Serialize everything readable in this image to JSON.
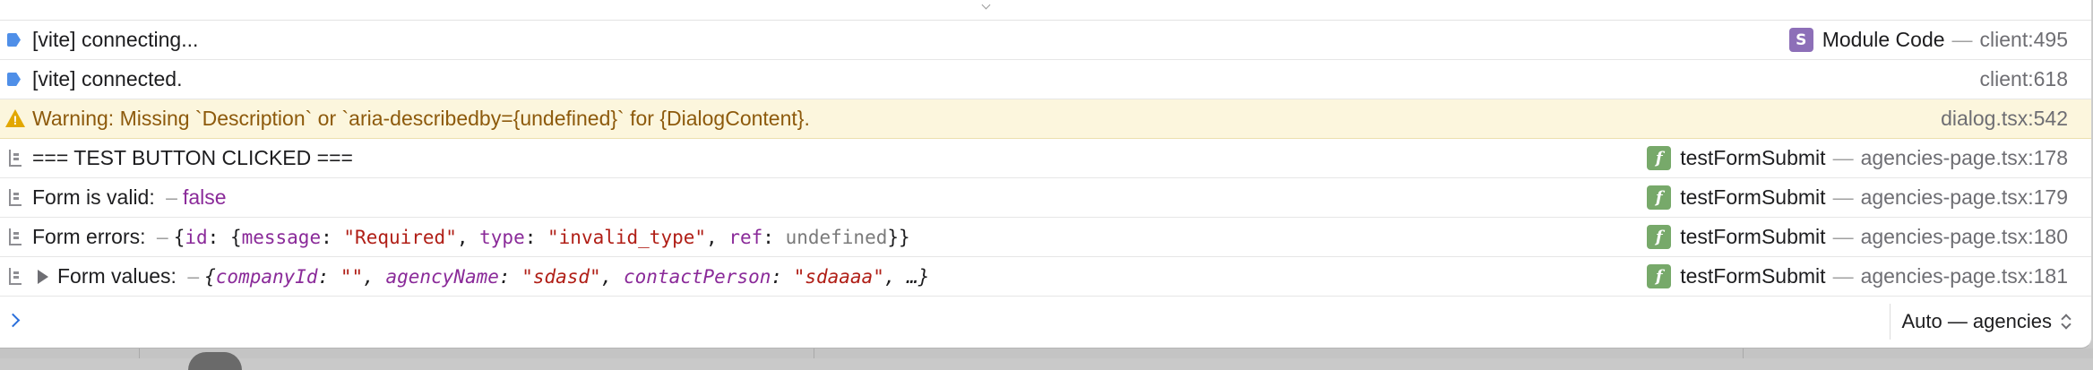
{
  "console": {
    "rows": [
      {
        "type": "log",
        "icon": "vite-log-icon",
        "text": "[vite] connecting...",
        "badge": "S",
        "badge_color": "#8d6fb8",
        "source_fn": "Module Code",
        "location": "client:495"
      },
      {
        "type": "log",
        "icon": "vite-log-icon",
        "text": "[vite] connected.",
        "location": "client:618"
      },
      {
        "type": "warning",
        "icon": "warning-icon",
        "text": "Warning: Missing `Description` or `aria-describedby={undefined}` for {DialogContent}.",
        "location": "dialog.tsx:542",
        "color": "#8d5a0c"
      },
      {
        "type": "group",
        "icon": "console-group-icon",
        "text": "=== TEST BUTTON CLICKED ===",
        "badge": "f",
        "source_fn": "testFormSubmit",
        "location": "agencies-page.tsx:178"
      },
      {
        "type": "group",
        "icon": "console-group-icon",
        "label": "Form is valid:",
        "dash": "–",
        "value": "false",
        "badge": "f",
        "source_fn": "testFormSubmit",
        "location": "agencies-page.tsx:179"
      },
      {
        "type": "group",
        "icon": "console-group-icon",
        "label": "Form errors:",
        "dash": "–",
        "obj": {
          "open": "{",
          "id_key": "id",
          "colon": ":",
          "inner_open": " {",
          "k1": "message",
          "v1": "\"Required\"",
          "k2": "type",
          "v2": "\"invalid_type\"",
          "k3": "ref",
          "v3": "undefined",
          "close": "}}"
        },
        "badge": "f",
        "source_fn": "testFormSubmit",
        "location": "agencies-page.tsx:180"
      },
      {
        "type": "group",
        "icon": "console-group-icon",
        "label": "Form values:",
        "dash": "–",
        "obj": {
          "open": "{",
          "k1": "companyId",
          "v1": "\"\"",
          "k2": "agencyName",
          "v2": "\"sdasd\"",
          "k3": "contactPerson",
          "v3": "\"sdaaaa\"",
          "rest": ", …}"
        },
        "badge": "f",
        "source_fn": "testFormSubmit",
        "location": "agencies-page.tsx:181"
      }
    ],
    "separator": "—",
    "prompt": {
      "value": "",
      "placeholder": ""
    },
    "context_selector": "Auto — agencies"
  },
  "colors": {
    "accent": "#2a6fdb",
    "warning_bg": "#fcf6dd",
    "string": "#b01e16",
    "key": "#8a2a99",
    "badge_f": "#77a96a",
    "badge_s": "#8d6fb8"
  }
}
